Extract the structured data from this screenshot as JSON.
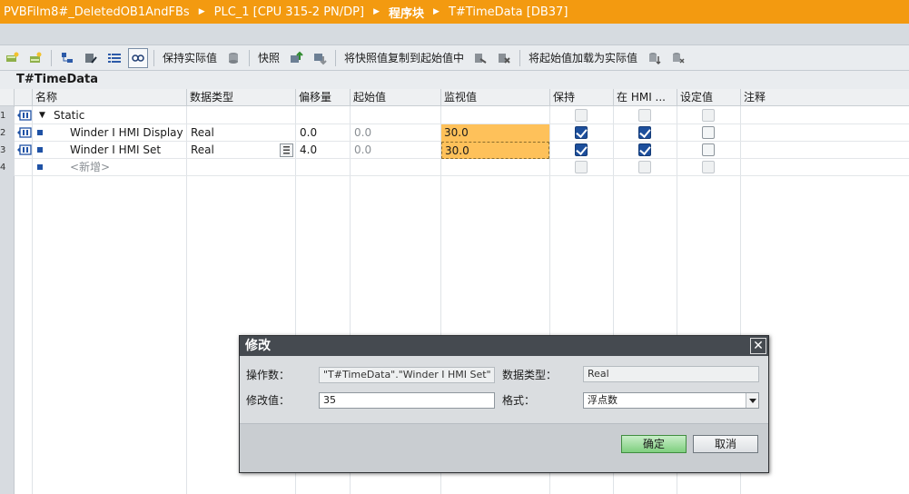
{
  "titlebar": {
    "crumbs": [
      "PVBFilm8#_DeletedOB1AndFBs",
      "PLC_1 [CPU 315-2 PN/DP]",
      "程序块",
      "T#TimeData [DB37]"
    ]
  },
  "toolbar": {
    "keep_actual": "保持实际值",
    "snapshot": "快照",
    "copy_snapshot": "将快照值复制到起始值中",
    "load_start": "将起始值加载为实际值"
  },
  "block_title": "T#TimeData",
  "columns": {
    "name": "名称",
    "datatype": "数据类型",
    "offset": "偏移量",
    "start": "起始值",
    "monitor": "监视值",
    "retain": "保持",
    "hmi": "在 HMI ...",
    "setpoint": "设定值",
    "comment": "注释"
  },
  "rows": [
    {
      "num": "1",
      "name": "Static",
      "datatype": "",
      "offset": "",
      "start": "",
      "monitor": "",
      "retain": false,
      "hmi": false,
      "setpoint": false
    },
    {
      "num": "2",
      "name": "Winder I HMI Display",
      "datatype": "Real",
      "offset": "0.0",
      "start": "0.0",
      "monitor": "30.0",
      "retain": true,
      "hmi": true,
      "setpoint": false
    },
    {
      "num": "3",
      "name": "Winder I HMI Set",
      "datatype": "Real",
      "offset": "4.0",
      "start": "0.0",
      "monitor": "30.0",
      "retain": true,
      "hmi": true,
      "setpoint": false
    },
    {
      "num": "4",
      "name": "<新增>",
      "datatype": "",
      "offset": "",
      "start": "",
      "monitor": "",
      "retain": false,
      "hmi": false,
      "setpoint": false
    }
  ],
  "dialog": {
    "title": "修改",
    "operand_label": "操作数：",
    "operand_value": "\"T#TimeData\".\"Winder I HMI Set\" / %",
    "datatype_label": "数据类型：",
    "datatype_value": "Real",
    "modify_label": "修改值：",
    "modify_value": "35",
    "format_label": "格式：",
    "format_value": "浮点数",
    "ok": "确定",
    "cancel": "取消"
  },
  "colors": {
    "titlebar": "#f39a10",
    "monitor_highlight": "#fec15a",
    "checkbox_on": "#1d4f9c",
    "dialog_title": "#454a50"
  }
}
